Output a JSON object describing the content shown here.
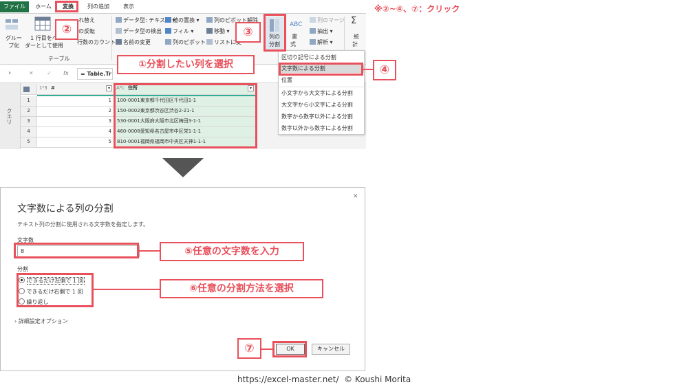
{
  "note": "※②~④、⑦：クリック",
  "tabs": [
    "ファイル",
    "ホーム",
    "変換",
    "列の追加",
    "表示"
  ],
  "ribbon": {
    "group_by": "グルー\nプ化",
    "first_row_header": "1 行目をヘ\nダーとして使用",
    "transpose": "れ替え",
    "reverse": "の反転",
    "count_rows": "行数のカウント",
    "table_group_label": "テーブル",
    "data_type": "データ型: テキスト",
    "detect_type": "データ型の検出",
    "rename": "名前の変更",
    "replace_values": "値の置換",
    "fill": "フィル",
    "pivot": "列のピボット",
    "unpivot": "列のピボット解除",
    "move": "移動",
    "to_list": "リストに変",
    "split_column_1": "列の",
    "split_column_2": "分割",
    "format_1": "書",
    "format_2": "式",
    "merge_columns": "列のマージ",
    "extract": "抽出",
    "parse": "解析",
    "stats_1": "統",
    "stats_2": "計"
  },
  "formula": "= Table.Tr",
  "side_label": "クエリ",
  "grid": {
    "col1_type": "1²3",
    "col1_name": "#",
    "col2_type": "Aᴮc",
    "col2_name": "住所",
    "rows": [
      {
        "n": "1",
        "v": "1",
        "addr": "100-0001東京都千代田区千代田1-1"
      },
      {
        "n": "2",
        "v": "2",
        "addr": "150-0002東京都渋谷区渋谷2-21-1"
      },
      {
        "n": "3",
        "v": "3",
        "addr": "530-0001大阪府大阪市北区梅田3-1-1"
      },
      {
        "n": "4",
        "v": "4",
        "addr": "460-0008愛知県名古屋市中区栄1-1-1"
      },
      {
        "n": "5",
        "v": "5",
        "addr": "810-0001福岡県福岡市中央区天神1-1-1"
      }
    ]
  },
  "menu": [
    "区切り記号による分割",
    "文字数による分割",
    "位置",
    "小文字から大文字による分割",
    "大文字から小文字による分割",
    "数字から数字以外による分割",
    "数字以外から数字による分割"
  ],
  "callouts": {
    "c1": "①分割したい列を選択",
    "c2": "②",
    "c3": "③",
    "c4": "④",
    "c5": "⑤任意の文字数を入力",
    "c6": "⑥任意の分割方法を選択",
    "c7": "⑦"
  },
  "dialog": {
    "title": "文字数による列の分割",
    "description": "テキスト列の分割に使用される文字数を指定します。",
    "chars_label": "文字数",
    "chars_value": "8",
    "split_label": "分割",
    "options": [
      "できるだけ左側で 1 回",
      "できるだけ右側で 1 回",
      "繰り返し"
    ],
    "advanced": "詳細設定オプション",
    "ok": "OK",
    "cancel": "キャンセル",
    "close": "✕"
  },
  "footer": "https://excel-master.net/  © Koushi Morita",
  "colors": {
    "accent": "#e8505b",
    "excel_green": "#217346",
    "selection_green": "#dff0e4"
  }
}
